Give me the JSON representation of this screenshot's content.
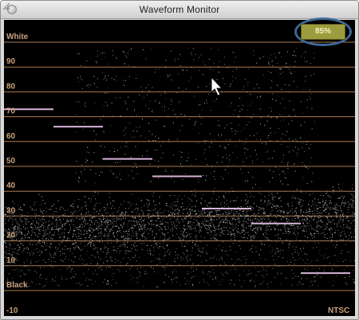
{
  "window": {
    "title": "Waveform Monitor"
  },
  "monitor": {
    "zoom_readout": "85%",
    "standard_label": "NTSC",
    "scale": [
      {
        "label": "White",
        "ire": 100
      },
      {
        "label": "90",
        "ire": 90
      },
      {
        "label": "80",
        "ire": 80
      },
      {
        "label": "70",
        "ire": 70
      },
      {
        "label": "60",
        "ire": 60
      },
      {
        "label": "50",
        "ire": 50
      },
      {
        "label": "40",
        "ire": 40
      },
      {
        "label": "30",
        "ire": 30
      },
      {
        "label": "20",
        "ire": 20
      },
      {
        "label": "10",
        "ire": 10
      },
      {
        "label": "Black",
        "ire": 0
      },
      {
        "label": "-10",
        "ire": -10
      }
    ],
    "colors": {
      "graticule": "#a87a52",
      "label": "#c8a27c",
      "trace": "#e8e8e8",
      "steps": "#d8b4d8",
      "background": "#000000",
      "highlight_ring": "#3f6896"
    },
    "step_levels_ire": [
      73,
      66,
      53,
      46,
      33,
      27,
      7
    ]
  }
}
